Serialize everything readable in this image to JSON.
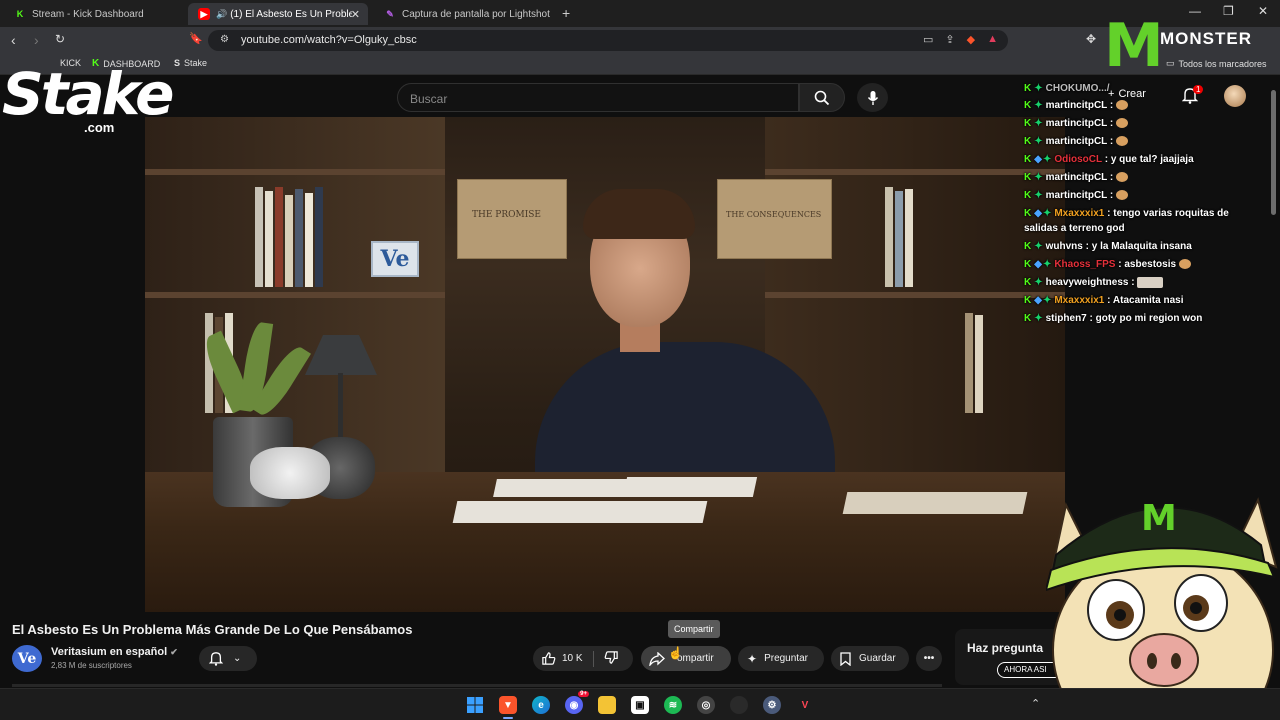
{
  "browser": {
    "tabs": [
      {
        "label": "Stream - Kick Dashboard",
        "icon": "kick-icon",
        "active": false
      },
      {
        "label": "(1) El Asbesto Es Un Problema",
        "icon": "youtube-icon",
        "active": true
      },
      {
        "label": "Captura de pantalla por Lightshot",
        "icon": "lightshot-icon",
        "active": false
      }
    ],
    "new_tab_label": "+",
    "url": "youtube.com/watch?v=Olguky_cbsc",
    "extension_badge": "99+",
    "bookmarks": [
      {
        "label": "KICK",
        "icon": "kick-icon"
      },
      {
        "label": "DASHBOARD",
        "icon": "kick-icon"
      },
      {
        "label": "Stake",
        "icon": "stake-icon"
      }
    ],
    "all_bookmarks_label": "Todos los marcadores"
  },
  "youtube": {
    "search_placeholder": "Buscar",
    "create_label": "Crear",
    "notification_count": "1",
    "video_title": "El Asbesto Es Un Problema Más Grande De Lo Que Pensábamos",
    "channel": {
      "name": "Veritasium en español",
      "subscribers": "2,83 M de suscriptores",
      "avatar_text": "Ve"
    },
    "likes": "10 K",
    "share_label": "Compartir",
    "share_label_visible": "ompartir",
    "ask_label": "Preguntar",
    "save_label": "Guardar",
    "tooltip": "Compartir",
    "ask_box_title": "Haz pregunta",
    "ask_box_button": "AHORA ASI"
  },
  "video_scene": {
    "box_label_left": "THE PROMISE",
    "box_label_right": "THE CONSEQUENCES",
    "sign": "Ve"
  },
  "overlays": {
    "stake_logo": "Stake",
    "stake_domain": ".com",
    "monster_word": "MONSTER",
    "chat_top_cut": "CHOKUMO.../"
  },
  "chat": [
    {
      "user": "martincitpCL",
      "user_color": "#ffffff",
      "message": "",
      "badges": [
        "k",
        "g"
      ],
      "emote": "emote-o"
    },
    {
      "user": "martincitpCL",
      "user_color": "#ffffff",
      "message": "",
      "badges": [
        "k",
        "g"
      ],
      "emote": "emote-o"
    },
    {
      "user": "martincitpCL",
      "user_color": "#ffffff",
      "message": "",
      "badges": [
        "k",
        "g"
      ],
      "emote": "emote-o"
    },
    {
      "user": "OdiosoCL",
      "user_color": "#e5303a",
      "message": "y que tal? jaajjaja",
      "badges": [
        "k",
        "b",
        "g"
      ],
      "emote": ""
    },
    {
      "user": "martincitpCL",
      "user_color": "#ffffff",
      "message": "",
      "badges": [
        "k",
        "g"
      ],
      "emote": "emote-o"
    },
    {
      "user": "martincitpCL",
      "user_color": "#ffffff",
      "message": "",
      "badges": [
        "k",
        "g"
      ],
      "emote": "emote-o"
    },
    {
      "user": "Mxaxxxix1",
      "user_color": "#f0a020",
      "message": "tengo varias roquitas de salidas a terreno god",
      "badges": [
        "k",
        "b",
        "g"
      ],
      "emote": ""
    },
    {
      "user": "wuhvns",
      "user_color": "#ffffff",
      "message": "y la Malaquita insana",
      "badges": [
        "k",
        "g"
      ],
      "emote": ""
    },
    {
      "user": "Khaoss_FPS",
      "user_color": "#e5303a",
      "message": "asbestosis",
      "badges": [
        "k",
        "g"
      ],
      "emote": "emote-cat"
    },
    {
      "user": "heavyweightness",
      "user_color": "#ffffff",
      "message": "",
      "badges": [
        "k",
        "g"
      ],
      "emote": "emote-wide"
    },
    {
      "user": "Mxaxxxix1",
      "user_color": "#f0a020",
      "message": "Atacamita nasi",
      "badges": [
        "k",
        "b",
        "g"
      ],
      "emote": ""
    },
    {
      "user": "stiphen7",
      "user_color": "#ffffff",
      "message": "goty po mi region won",
      "badges": [
        "k",
        "g"
      ],
      "emote": ""
    }
  ],
  "colors": {
    "kick_green": "#53fc18",
    "youtube_red": "#ff0000",
    "monster_green": "#63d12a",
    "page_bg": "#0f0f0f"
  },
  "taskbar": {
    "icons": [
      "windows-icon",
      "brave-icon",
      "edge-icon",
      "discord-icon",
      "file-explorer-icon",
      "camera-icon",
      "spotify-icon",
      "obs-icon",
      "steam-icon",
      "settings-icon",
      "valorant-icon"
    ],
    "discord_badge": "9+"
  }
}
